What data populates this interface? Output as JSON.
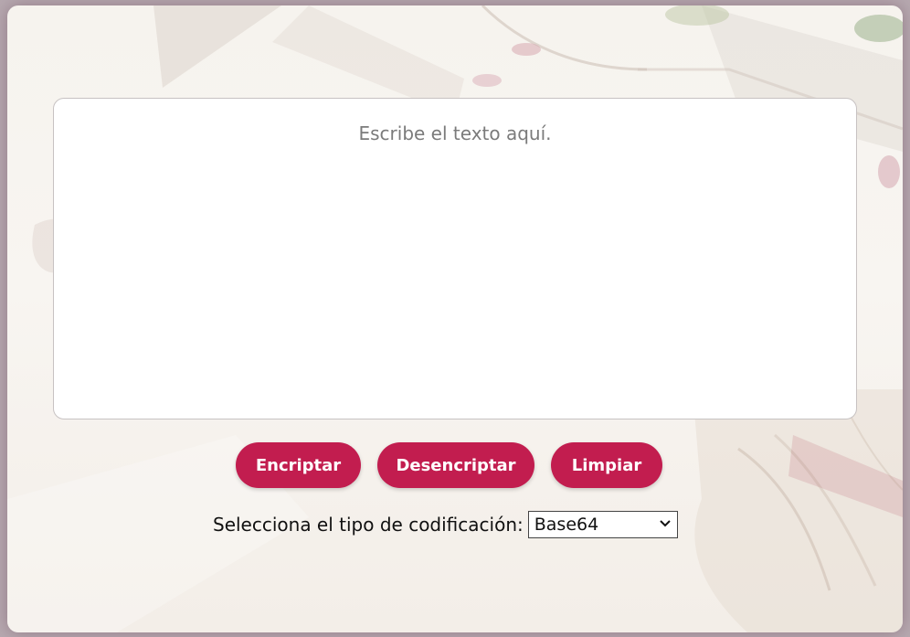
{
  "editor": {
    "placeholder": "Escribe el texto aquí.",
    "value": ""
  },
  "actions": {
    "encrypt_label": "Encriptar",
    "decrypt_label": "Desencriptar",
    "clear_label": "Limpiar"
  },
  "encoding": {
    "label": "Selecciona el tipo de codificación:",
    "selected": "Base64",
    "options": [
      "Base64"
    ]
  },
  "icons": {
    "select_chevron": "chevron-down-icon"
  },
  "colors": {
    "accent": "#c21d4f",
    "page_bg": "#f7f4ef",
    "textarea_bg": "#ffffff"
  }
}
